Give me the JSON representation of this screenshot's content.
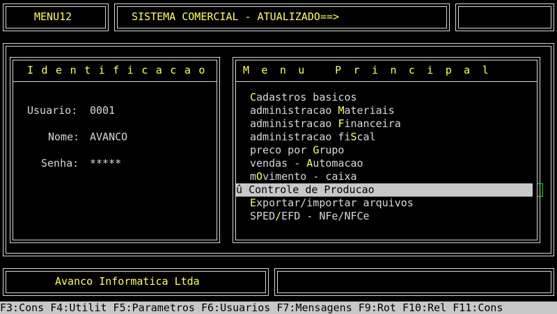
{
  "header": {
    "menu_code": "MENU12",
    "system_title": "SISTEMA COMERCIAL - ATUALIZADO==>",
    "right_box": ""
  },
  "identification": {
    "title": "Identificacao",
    "user_label": "Usuario:",
    "user_value": "0001",
    "name_label": "Nome:",
    "name_value": "AVANCO",
    "password_label": "Senha:",
    "password_value": "*****"
  },
  "main_menu": {
    "title": "Menu Principal",
    "selected_marker": "û",
    "items": [
      {
        "pre": "",
        "hot": "C",
        "post": "adastros basicos"
      },
      {
        "pre": "administracao ",
        "hot": "M",
        "post": "ateriais"
      },
      {
        "pre": "administracao ",
        "hot": "F",
        "post": "inanceira"
      },
      {
        "pre": "administracao fi",
        "hot": "S",
        "post": "cal"
      },
      {
        "pre": "preco por ",
        "hot": "G",
        "post": "rupo"
      },
      {
        "pre": "vendas - ",
        "hot": "A",
        "post": "utomacao"
      },
      {
        "pre": "m",
        "hot": "O",
        "post": "vimento - caixa"
      },
      {
        "pre": "",
        "hot": "",
        "post": "Controle de Producao"
      },
      {
        "pre": "",
        "hot": "E",
        "post": "xportar/importar arquivos"
      },
      {
        "pre": "SPED",
        "hot": "/",
        "post": "EFD - NFe/NFCe"
      }
    ],
    "selected_index": 7
  },
  "footer": {
    "company": "Avanco Informatica Ltda",
    "right_box": ""
  },
  "function_keys": "F3:Cons F4:Utilit F5:Parametros F6:Usuarios F7:Mensagens F9:Rot F10:Rel F11:Cons"
}
